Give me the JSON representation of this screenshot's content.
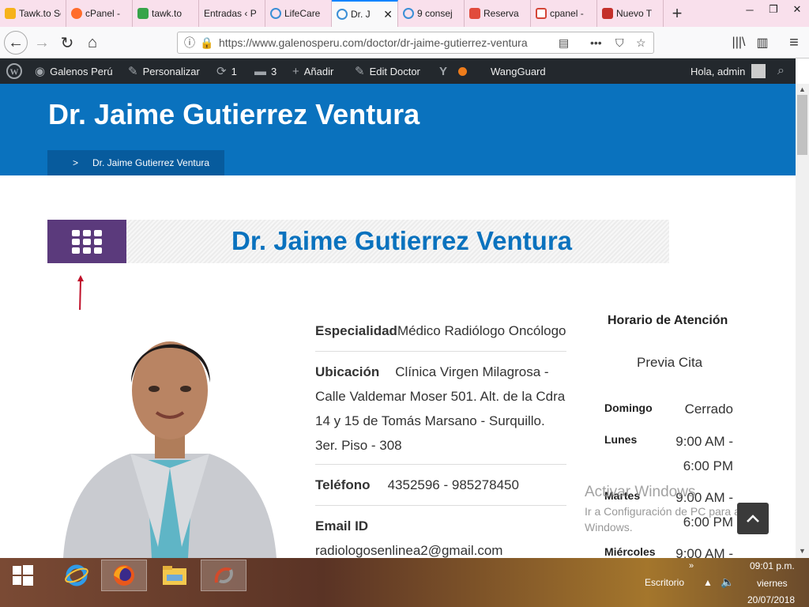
{
  "browser": {
    "tabs": [
      {
        "label": "Tawk.to Sett",
        "color": "#f6b21b"
      },
      {
        "label": "cPanel -",
        "color": "#ff6c2c"
      },
      {
        "label": "tawk.to",
        "color": "#37a44a"
      },
      {
        "label": "Entradas ‹ P",
        "color": "#f9e0ec"
      },
      {
        "label": "LifeCare",
        "color": "#3b8fd6"
      },
      {
        "label": "Dr. J",
        "color": "#3b8fd6"
      },
      {
        "label": "9 consej",
        "color": "#3b8fd6"
      },
      {
        "label": "Reserva",
        "color": "#e14b3c"
      },
      {
        "label": "cpanel -",
        "color": "#d44638"
      },
      {
        "label": "Nuevo T",
        "color": "#c4302b"
      }
    ],
    "url": "https://www.galenosperu.com/doctor/dr-jaime-gutierrez-ventura"
  },
  "adminbar": {
    "site": "Galenos Perú",
    "customize": "Personalizar",
    "updates": "1",
    "comments": "3",
    "add": "Añadir",
    "edit": "Edit Doctor",
    "wangguard": "WangGuard",
    "greeting": "Hola, admin"
  },
  "header": {
    "title": "Dr. Jaime Gutierrez Ventura",
    "breadcrumb_sep": ">",
    "breadcrumb": "Dr. Jaime Gutierrez Ventura"
  },
  "doctor": {
    "name": "Dr. Jaime Gutierrez Ventura",
    "specialty_label": "Especialidad",
    "specialty": "Médico Radiólogo Oncólogo",
    "location_label": "Ubicación",
    "location": "Clínica Virgen Milagrosa - Calle Valdemar Moser 501. Alt. de la Cdra 14 y 15 de Tomás Marsano - Surquillo. 3er. Piso - 308",
    "phone_label": "Teléfono",
    "phone": "4352596 - 985278450",
    "email_label": "Email ID",
    "email": "radiologosenlinea2@gmail.com"
  },
  "schedule": {
    "title": "Horario de Atención",
    "note": "Previa Cita",
    "days": [
      {
        "day": "Domingo",
        "time": "Cerrado"
      },
      {
        "day": "Lunes",
        "time": "9:00 AM - 6:00 PM"
      },
      {
        "day": "Martes",
        "time": "9:00 AM - 6:00 PM"
      },
      {
        "day": "Miércoles",
        "time": "9:00 AM -"
      }
    ]
  },
  "watermark": {
    "line1": "Activar Windows",
    "line2": "Ir a Configuración de PC para activar Windows."
  },
  "taskbar": {
    "desktop": "Escritorio",
    "time": "09:01 p.m.",
    "day": "viernes",
    "date": "20/07/2018"
  },
  "colors": {
    "brand_blue": "#0a72be",
    "purple": "#5b3a7c",
    "adminbar": "#23282d"
  }
}
